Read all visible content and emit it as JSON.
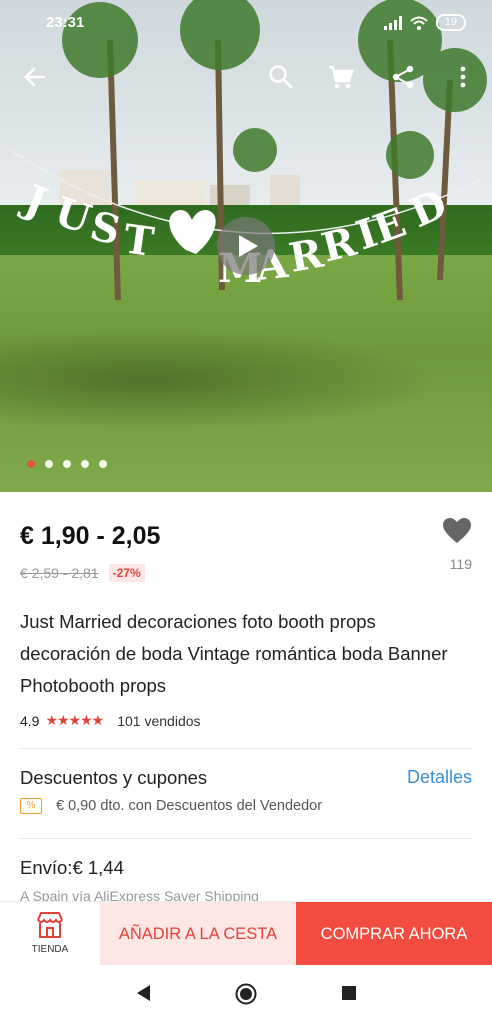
{
  "status_bar": {
    "time": "23:31",
    "battery": "19"
  },
  "hero": {
    "banner_text": "JUST MARRIED",
    "image_count": 5,
    "active_index": 0
  },
  "product": {
    "price": "€ 1,90 - 2,05",
    "original_price": "€ 2,59 - 2,81",
    "discount": "-27%",
    "wishlist_count": "119",
    "title": "Just Married decoraciones foto booth props decoración de boda Vintage romántica boda Banner Photobooth props",
    "rating": "4.9",
    "stars": "★★★★★",
    "sold": "101 vendidos"
  },
  "coupons": {
    "title": "Descuentos y cupones",
    "link": "Detalles",
    "tag": "%",
    "text": "€ 0,90 dto. con Descuentos del Vendedor"
  },
  "shipping": {
    "title": "Envío:€ 1,44",
    "subtitle": "A Spain vía AliExpress Saver Shipping"
  },
  "actions": {
    "store_label": "TIENDA",
    "add_to_cart": "AÑADIR A LA CESTA",
    "buy_now": "COMPRAR AHORA"
  },
  "colors": {
    "accent": "#f24b3f",
    "link": "#3a8fd6",
    "cart_bg": "#fde6e4"
  }
}
